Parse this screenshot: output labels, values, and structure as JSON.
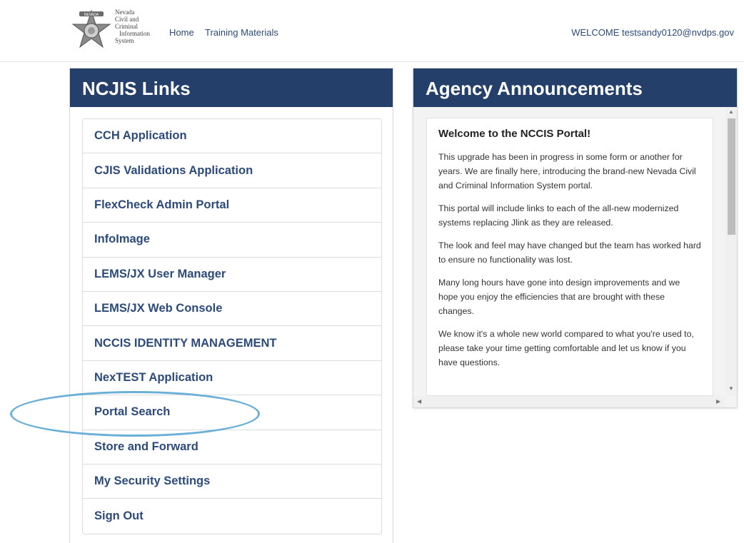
{
  "header": {
    "logo": {
      "badge_text": "NEVADA",
      "text_lines": [
        "Nevada",
        "Civil and",
        "Criminal",
        "Information",
        "System"
      ]
    },
    "nav": [
      {
        "label": "Home"
      },
      {
        "label": "Training Materials"
      }
    ],
    "welcome": "WELCOME testsandy0120@nvdps.gov"
  },
  "links_panel": {
    "title": "NCJIS Links",
    "items": [
      {
        "label": "CCH Application"
      },
      {
        "label": "CJIS Validations Application"
      },
      {
        "label": "FlexCheck Admin Portal"
      },
      {
        "label": "InfoImage"
      },
      {
        "label": "LEMS/JX User Manager"
      },
      {
        "label": "LEMS/JX Web Console"
      },
      {
        "label": "NCCIS IDENTITY MANAGEMENT"
      },
      {
        "label": "NexTEST Application"
      },
      {
        "label": "Portal Search"
      },
      {
        "label": "Store and Forward"
      },
      {
        "label": "My Security Settings"
      },
      {
        "label": "Sign Out"
      }
    ]
  },
  "announcements": {
    "title": "Agency Announcements",
    "card_title": "Welcome to the NCCIS Portal!",
    "paragraphs": [
      "This upgrade has been in progress in some form or another for years. We are finally here, introducing the brand-new Nevada Civil and Criminal Information System portal.",
      "This portal will include links to each of the all-new modernized systems replacing Jlink as they are released.",
      "The look and feel may have changed but the team has worked hard to ensure no functionality was lost.",
      "Many long hours have gone into design improvements and we hope you enjoy the efficiencies that are brought with these changes.",
      "We know it's a whole new world compared to what you're used to, please take your time getting comfortable and let us know if you have questions."
    ]
  },
  "colors": {
    "header_bg": "#243f6a",
    "link_text": "#2c4a7a",
    "highlight_ring": "#6aafd8"
  },
  "icons": {
    "logo": "nevada-star-badge",
    "scroll_up": "triangle-up",
    "scroll_down": "triangle-down",
    "scroll_left": "triangle-left",
    "scroll_right": "triangle-right"
  }
}
